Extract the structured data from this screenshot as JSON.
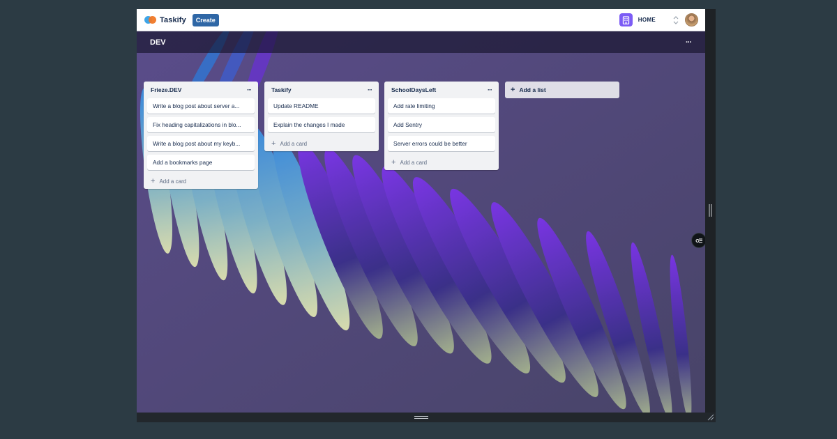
{
  "app": {
    "logo_text": "Taskify",
    "create_label": "Create",
    "org_name": "HOME"
  },
  "board": {
    "title": "DEV",
    "menu": "···",
    "lists": [
      {
        "title": "Frieze.DEV",
        "menu": "···",
        "cards": [
          "Write a blog post about server a...",
          "Fix heading capitalizations in blo...",
          "Write a blog post about my keyb...",
          "Add a bookmarks page"
        ],
        "add_card": "Add a card"
      },
      {
        "title": "Taskify",
        "menu": "···",
        "cards": [
          "Update README",
          "Explain the changes I made"
        ],
        "add_card": "Add a card"
      },
      {
        "title": "SchoolDaysLeft",
        "menu": "···",
        "cards": [
          "Add rate limiting",
          "Add Sentry",
          "Server errors could be better"
        ],
        "add_card": "Add a card"
      }
    ],
    "add_list": "Add a list"
  },
  "colors": {
    "page_bg": "#2c3b44",
    "navbar_bg": "#ffffff",
    "create_button": "#2f67a6",
    "org_icon": "#7c5cf5",
    "list_bg": "#f1f2f4",
    "card_bg": "#ffffff",
    "text_dark": "#172b4d",
    "text_muted": "#5e6c84"
  },
  "icons": {
    "logo": "taskify-logo-icon",
    "org": "building-icon",
    "switcher": "chevron-up-down-icon",
    "avatar": "user-avatar",
    "plus": "plus-icon",
    "float": "toggle-icon",
    "resize": "resize-grip-icon"
  }
}
